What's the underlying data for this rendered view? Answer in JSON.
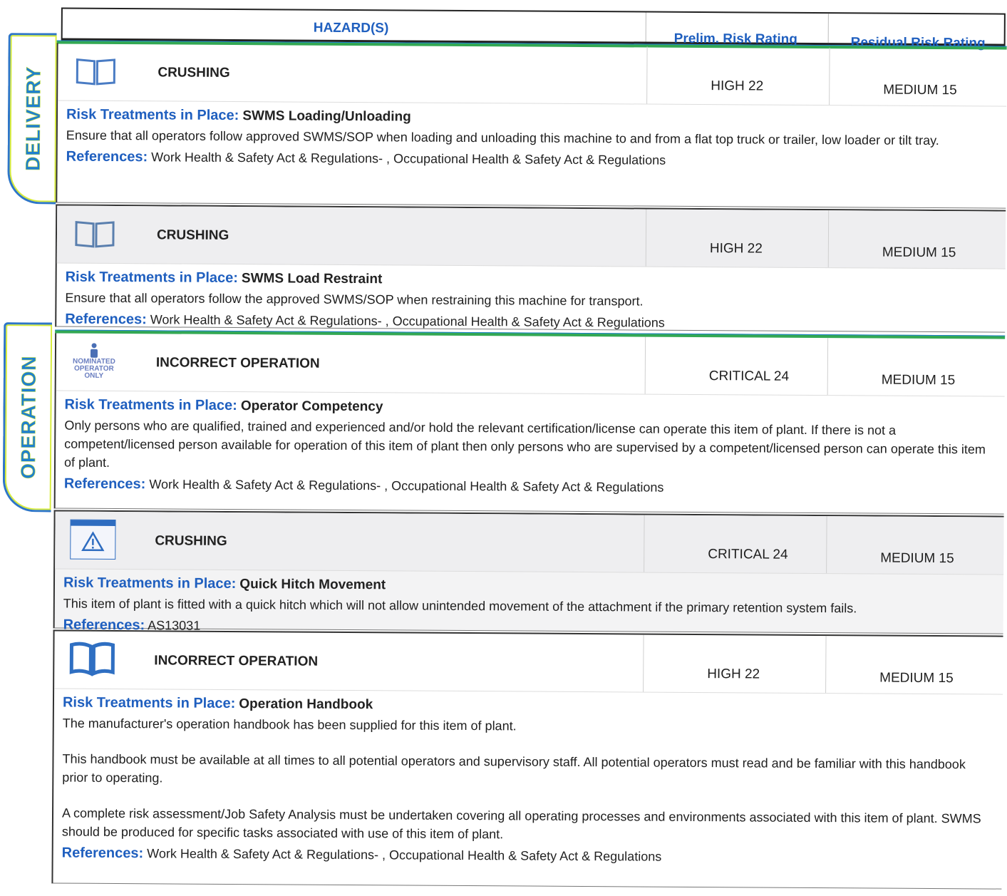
{
  "header": {
    "hazards": "HAZARD(S)",
    "prelim": "Prelim. Risk Rating",
    "residual": "Residual Risk Rating"
  },
  "sections": {
    "delivery": "DELIVERY",
    "operation": "OPERATION"
  },
  "labels": {
    "risk_treatments": "Risk Treatments in Place:",
    "references": "References:"
  },
  "hazards": [
    {
      "icon": "book-icon",
      "name": "CRUSHING",
      "prelim": "HIGH 22",
      "residual": "MEDIUM 15",
      "treatment": "SWMS Loading/Unloading",
      "description": [
        "Ensure that all operators follow approved SWMS/SOP when loading and unloading this machine to and from a flat top truck or trailer, low loader or tilt tray."
      ],
      "references": "Work Health & Safety Act & Regulations- , Occupational Health & Safety Act & Regulations"
    },
    {
      "icon": "book-icon",
      "name": "CRUSHING",
      "prelim": "HIGH 22",
      "residual": "MEDIUM 15",
      "treatment": "SWMS Load Restraint",
      "description": [
        "Ensure that all operators follow the approved SWMS/SOP when restraining this machine for transport."
      ],
      "references": "Work Health & Safety Act & Regulations- , Occupational Health & Safety Act & Regulations"
    },
    {
      "icon": "nominated-operator-icon",
      "icon_text": [
        "NOMINATED",
        "OPERATOR",
        "ONLY"
      ],
      "name": "INCORRECT OPERATION",
      "prelim": "CRITICAL 24",
      "residual": "MEDIUM 15",
      "treatment": "Operator Competency",
      "description": [
        "Only persons who are qualified, trained and experienced and/or hold the relevant certification/license can operate this item of plant. If there is not a competent/licensed person available for operation of this item of plant then only persons who are supervised by a competent/licensed person can operate this item of plant."
      ],
      "references": "Work Health & Safety Act & Regulations- , Occupational Health & Safety Act & Regulations"
    },
    {
      "icon": "warning-card-icon",
      "name": "CRUSHING",
      "prelim": "CRITICAL 24",
      "residual": "MEDIUM 15",
      "treatment": "Quick Hitch Movement",
      "description": [
        "This item of plant is fitted with a quick hitch which will not allow unintended movement of the attachment if the primary retention system fails."
      ],
      "references": "AS13031"
    },
    {
      "icon": "book-icon",
      "name": "INCORRECT OPERATION",
      "prelim": "HIGH 22",
      "residual": "MEDIUM 15",
      "treatment": "Operation Handbook",
      "description": [
        "The manufacturer's operation handbook has been supplied for this item of plant.",
        "This handbook must be available at all times to all potential operators and supervisory staff. All potential operators must read and be familiar with this handbook prior to operating.",
        "A complete risk assessment/Job Safety Analysis must be undertaken covering all operating processes and environments associated with this item of plant. SWMS should be produced for specific tasks associated with use of this item of plant."
      ],
      "references": "Work Health & Safety Act & Regulations- , Occupational Health & Safety Act & Regulations"
    }
  ],
  "colors": {
    "label_blue": "#1f5fbf",
    "tab_blue": "#1f7fd0",
    "tab_highlight": "#d7ec3a",
    "section_line": "#33a853"
  }
}
